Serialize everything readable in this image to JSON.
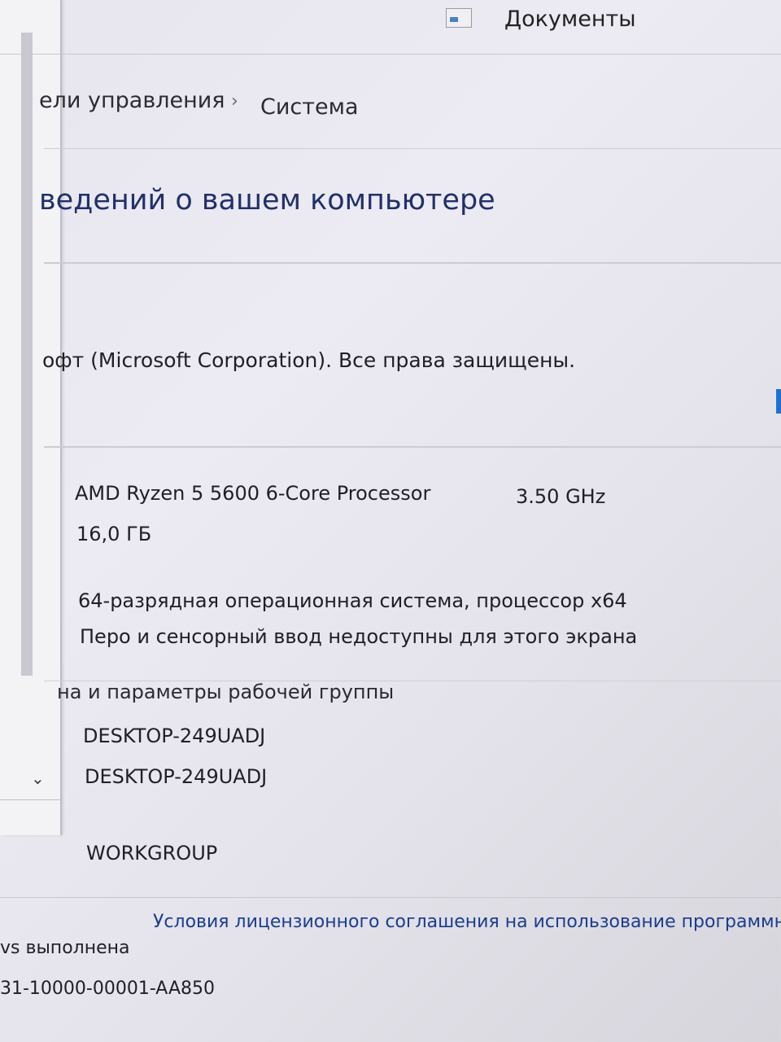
{
  "window": {
    "documents_label": "Документы"
  },
  "breadcrumb": {
    "parent": "ели управления",
    "separator": "›",
    "current": "Система"
  },
  "page": {
    "title": "ведений о вашем компьютере"
  },
  "windows_edition": {
    "copyright": "офт (Microsoft Corporation). Все права защищены."
  },
  "system": {
    "processor": "AMD Ryzen 5 5600 6-Core Processor",
    "clock_speed": "3.50 GHz",
    "ram": "16,0 ГБ",
    "system_type": "64-разрядная операционная система, процессор x64",
    "pen_touch": "Перо и сенсорный ввод недоступны для этого экрана"
  },
  "computer_name_section": {
    "heading": "на и параметры рабочей группы",
    "computer_name": "DESKTOP-249UADJ",
    "full_name": "DESKTOP-249UADJ",
    "workgroup": "WORKGROUP"
  },
  "activation": {
    "status": "vs выполнена",
    "license_link": "Условия лицензионного соглашения на использование программного",
    "product_id": "31-10000-00001-AA850"
  },
  "left_pane": {
    "chevron": "⌄"
  },
  "colors": {
    "title": "#21306a",
    "link": "#1a3d8c",
    "accent": "#1f6fd0"
  }
}
